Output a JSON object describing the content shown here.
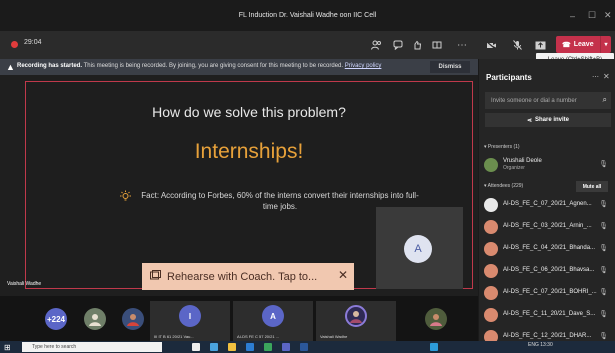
{
  "window": {
    "title": "FL Induction Dr. Vaishali Wadhe oon IIC Cell",
    "controls": [
      "–",
      "☐",
      "✕"
    ]
  },
  "toolbar": {
    "timer": "29:04",
    "leave_label": "Leave",
    "leave_tooltip": "Leave (Ctrl+Shift+B)"
  },
  "banner": {
    "bold": "Recording has started.",
    "text": " This meeting is being recorded. By joining, you are giving consent for this meeting to be recorded.",
    "link": "Privacy policy",
    "dismiss": "Dismiss"
  },
  "slide": {
    "title": "How do we solve this problem?",
    "heading": "Internships!",
    "fact": "Fact: According to Forbes, 60% of the interns convert their internships into full-time jobs."
  },
  "self_tile": {
    "initial": "A"
  },
  "coach": {
    "label": "Rehearse with Coach. Tap to...",
    "close": "✕"
  },
  "stage_name": "Vaishali Wadhe",
  "gallery": {
    "overflow": "+224",
    "tiles": [
      {
        "initial": "I",
        "label": "III IT B 61 20/21 Vau..."
      },
      {
        "initial": "A",
        "label": "AI-DS FE C 57 20/21 ..."
      },
      {
        "label": "Vaishali Wadhe"
      }
    ]
  },
  "participants": {
    "title": "Participants",
    "search_placeholder": "Invite someone or dial a number",
    "share_invite": "Share invite",
    "presenters_label": "Presenters (1)",
    "presenter": {
      "name": "Vrushali Deole",
      "role": "Organizer"
    },
    "attendees_label": "Attendees (229)",
    "mute_all": "Mute all",
    "attendees": [
      "AI-DS_FE_C_07_20/21_Agnen...",
      "AI-DS_FE_C_03_20/21_Arnin_...",
      "AI-DS_FE_C_04_20/21_Bhanda...",
      "AI-DS_FE_C_06_20/21_Bhavsa...",
      "AI-DS_FE_C_07_20/21_BOHRI_...",
      "AI-DS_FE_C_11_20/21_Dave_S...",
      "AI-DS_FE_C_12_20/21_DHAR..."
    ]
  },
  "taskbar": {
    "search_placeholder": "Type here to search",
    "tray": "ENG 13:30"
  }
}
